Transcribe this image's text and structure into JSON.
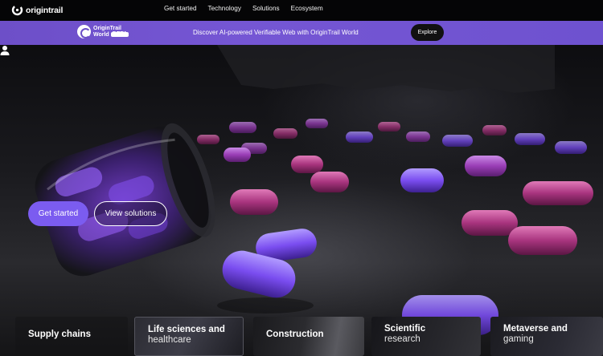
{
  "nav": {
    "logo_text": "origintrail",
    "items": [
      "Get started",
      "Technology",
      "Solutions",
      "Ecosystem"
    ]
  },
  "banner": {
    "brand_line1": "OriginTrail",
    "brand_line2": "World",
    "badge": "BETA",
    "text": "Discover AI-powered Verifiable Web with OriginTrail World",
    "cta": "Explore"
  },
  "hero": {
    "primary_button": "Get started",
    "secondary_button": "View solutions"
  },
  "cards": [
    {
      "line1": "Supply chains",
      "line2": ""
    },
    {
      "line1": "Life sciences and",
      "line2": "healthcare"
    },
    {
      "line1": "Construction",
      "line2": ""
    },
    {
      "line1": "Scientific",
      "line2": "research"
    },
    {
      "line1": "Metaverse and",
      "line2": "gaming"
    }
  ],
  "colors": {
    "accent": "#7b5cf0",
    "banner": "#6d4fc8",
    "nav_bg": "#050506"
  },
  "icons": [
    "origintrail-logo-icon",
    "origintrail-world-icon",
    "user-icon"
  ]
}
